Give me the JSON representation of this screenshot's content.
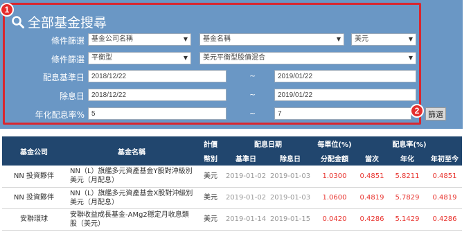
{
  "search": {
    "title": "全部基金搜尋",
    "badge_1": "1",
    "badge_2": "2",
    "rows": {
      "filter1": {
        "label": "條件篩選",
        "company": "基金公司名稱",
        "fund": "基金名稱",
        "currency": "美元"
      },
      "filter2": {
        "label": "條件篩選",
        "type": "平衡型",
        "category": "美元平衡型股債混合"
      },
      "base_date": {
        "label": "配息基準日",
        "from": "2018/12/22",
        "to": "2019/01/22"
      },
      "ex_date": {
        "label": "除息日",
        "from": "2018/12/22",
        "to": "2019/01/22"
      },
      "yield_rate": {
        "label": "年化配息率%",
        "from": "5",
        "to": "7"
      }
    },
    "tilde": "~",
    "filter_button": "篩選"
  },
  "table": {
    "headers_top": {
      "company": "基金公司",
      "name": "基金名稱",
      "currency_top": "計價",
      "dividend_date": "配息日期",
      "per_unit": "每單位(%)",
      "rate": "配息率(%)"
    },
    "headers_sub": {
      "currency": "幣別",
      "base_date": "基準日",
      "ex_date": "除息日",
      "amount": "分配金額",
      "this_time": "當次",
      "annual": "年化",
      "ytd": "年初至今"
    },
    "rows": [
      {
        "company": "NN 投資夥伴",
        "name": "NN（L）旗艦多元資產基金Y股對沖級別美元（月配息）",
        "currency": "美元",
        "base_date": "2019-01-02",
        "ex_date": "2019-01-03",
        "amount": "1.0300",
        "this_time": "0.4851",
        "annual": "5.8211",
        "ytd": "0.4851"
      },
      {
        "company": "NN 投資夥伴",
        "name": "NN（L）旗艦多元資產基金X股對沖級別美元（月配息）",
        "currency": "美元",
        "base_date": "2019-01-02",
        "ex_date": "2019-01-03",
        "amount": "1.0600",
        "this_time": "0.4819",
        "annual": "5.7829",
        "ytd": "0.4819"
      },
      {
        "company": "安聯環球",
        "name": "安聯收益成長基金-AMg2穩定月收息類股（美元）",
        "currency": "美元",
        "base_date": "2019-01-14",
        "ex_date": "2019-01-15",
        "amount": "0.0420",
        "this_time": "0.4286",
        "annual": "5.1429",
        "ytd": "0.4286"
      }
    ]
  },
  "colors": {
    "panel_bg": "#6a97c5",
    "highlight": "#d9262f",
    "table_header": "#21466e",
    "value_red": "#e8332e"
  }
}
